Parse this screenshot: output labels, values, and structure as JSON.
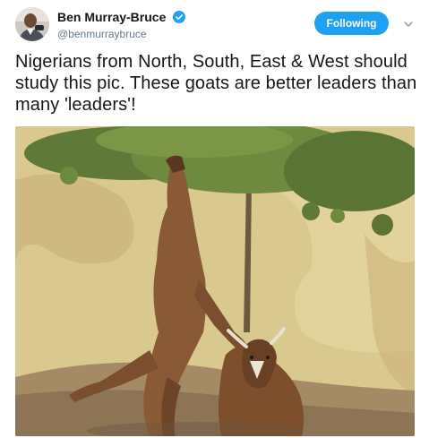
{
  "tweet": {
    "display_name": "Ben Murray-Bruce",
    "handle": "@benmurraybruce",
    "follow_label": "Following",
    "text": "Nigerians from North, South, East & West should study this pic. These goats are better leaders than many 'leaders'!"
  },
  "icons": {
    "verified": "verified-badge-icon",
    "caret": "chevron-down-icon"
  },
  "colors": {
    "accent": "#1da1f2",
    "text": "#14171a",
    "secondary": "#657786"
  }
}
